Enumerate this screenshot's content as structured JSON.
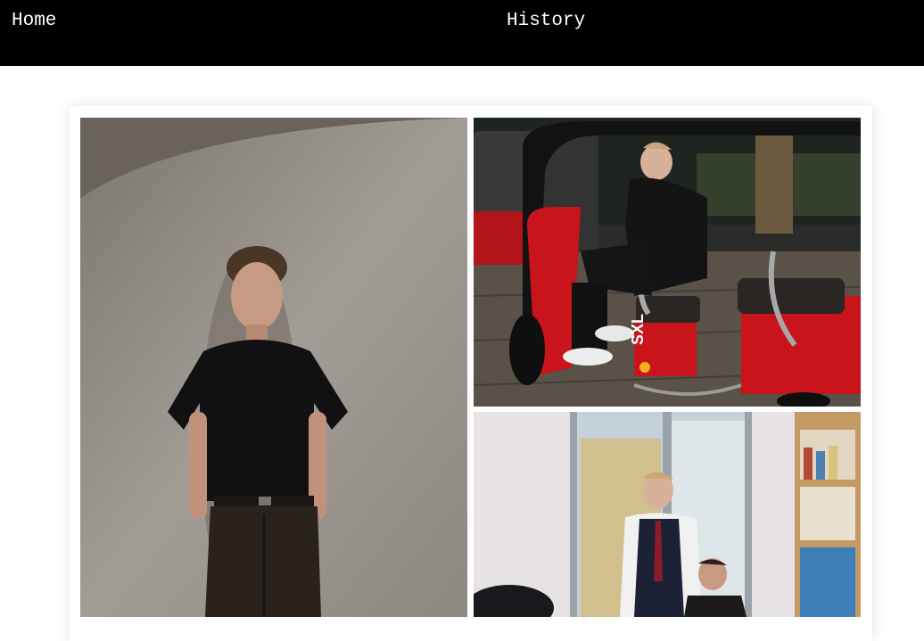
{
  "nav": {
    "home_label": "Home",
    "history_label": "History"
  },
  "gallery": {
    "photos": [
      {
        "alt": "Photo 1",
        "icon": "photo-portrait"
      },
      {
        "alt": "Photo 2",
        "icon": "photo-tuktuk"
      },
      {
        "alt": "Photo 3",
        "icon": "photo-classroom"
      }
    ],
    "tuktuk_branding": "SXL"
  },
  "colors": {
    "topbar": "#000000",
    "nav_text": "#ffffff",
    "page_bg": "#ffffff",
    "vehicle_red": "#c8141a"
  }
}
